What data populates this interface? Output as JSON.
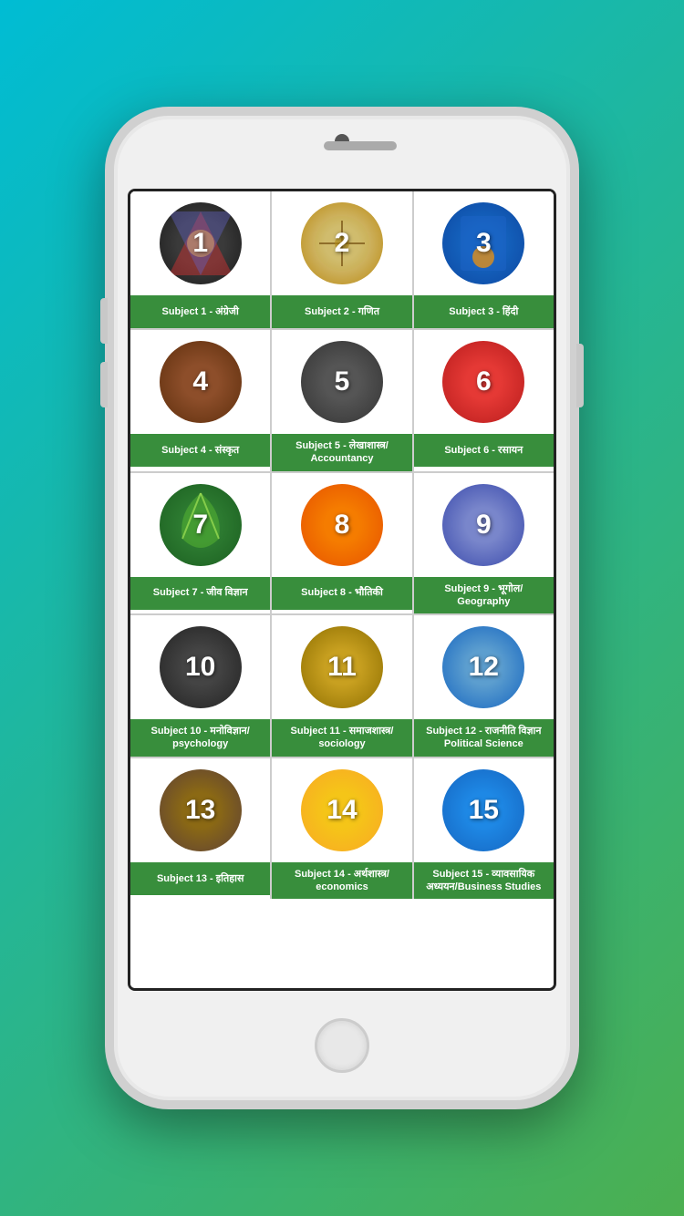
{
  "background": {
    "gradient_start": "#00bcd4",
    "gradient_end": "#4caf50"
  },
  "subjects": [
    {
      "id": 1,
      "number": "1",
      "label": "Subject 1 - अंग्रेजी",
      "circle_class": "circle-1"
    },
    {
      "id": 2,
      "number": "2",
      "label": "Subject 2 - गणित",
      "circle_class": "circle-2"
    },
    {
      "id": 3,
      "number": "3",
      "label": "Subject 3 - हिंदी",
      "circle_class": "circle-3"
    },
    {
      "id": 4,
      "number": "4",
      "label": "Subject 4 - संस्कृत",
      "circle_class": "circle-4"
    },
    {
      "id": 5,
      "number": "5",
      "label": "Subject 5 - लेखाशास्त्र/ Accountancy",
      "circle_class": "circle-5"
    },
    {
      "id": 6,
      "number": "6",
      "label": "Subject 6 - रसायन",
      "circle_class": "circle-6"
    },
    {
      "id": 7,
      "number": "7",
      "label": "Subject 7 - जीव विज्ञान",
      "circle_class": "circle-7"
    },
    {
      "id": 8,
      "number": "8",
      "label": "Subject 8 - भौतिकी",
      "circle_class": "circle-8"
    },
    {
      "id": 9,
      "number": "9",
      "label": "Subject 9 - भूगोल/ Geography",
      "circle_class": "circle-9"
    },
    {
      "id": 10,
      "number": "10",
      "label": "Subject 10 - मनोविज्ञान/ psychology",
      "circle_class": "circle-10"
    },
    {
      "id": 11,
      "number": "11",
      "label": "Subject 11 - समाजशास्त्र/ sociology",
      "circle_class": "circle-11"
    },
    {
      "id": 12,
      "number": "12",
      "label": "Subject 12 - राजनीति विज्ञान Political Science",
      "circle_class": "circle-12"
    },
    {
      "id": 13,
      "number": "13",
      "label": "Subject 13 - इतिहास",
      "circle_class": "circle-13"
    },
    {
      "id": 14,
      "number": "14",
      "label": "Subject 14 - अर्थशास्त्र/ economics",
      "circle_class": "circle-14"
    },
    {
      "id": 15,
      "number": "15",
      "label": "Subject 15 - व्यावसायिक अध्ययन/Business Studies",
      "circle_class": "circle-15"
    }
  ]
}
